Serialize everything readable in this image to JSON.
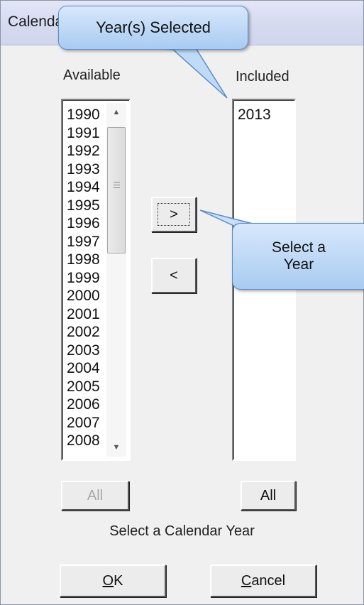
{
  "window": {
    "title": "Calendar Year"
  },
  "available": {
    "label": "Available",
    "items": [
      "1990",
      "1991",
      "1992",
      "1993",
      "1994",
      "1995",
      "1996",
      "1997",
      "1998",
      "1999",
      "2000",
      "2001",
      "2002",
      "2003",
      "2004",
      "2005",
      "2006",
      "2007",
      "2008"
    ],
    "all_label": "All"
  },
  "included": {
    "label": "Included",
    "items": [
      "2013"
    ],
    "all_label": "All"
  },
  "buttons": {
    "add": ">",
    "remove": "<",
    "ok": "OK",
    "cancel": "Cancel"
  },
  "hint": "Select a Calendar Year",
  "callouts": {
    "top": "Year(s) Selected",
    "side_line1": "Select a",
    "side_line2": "Year"
  }
}
